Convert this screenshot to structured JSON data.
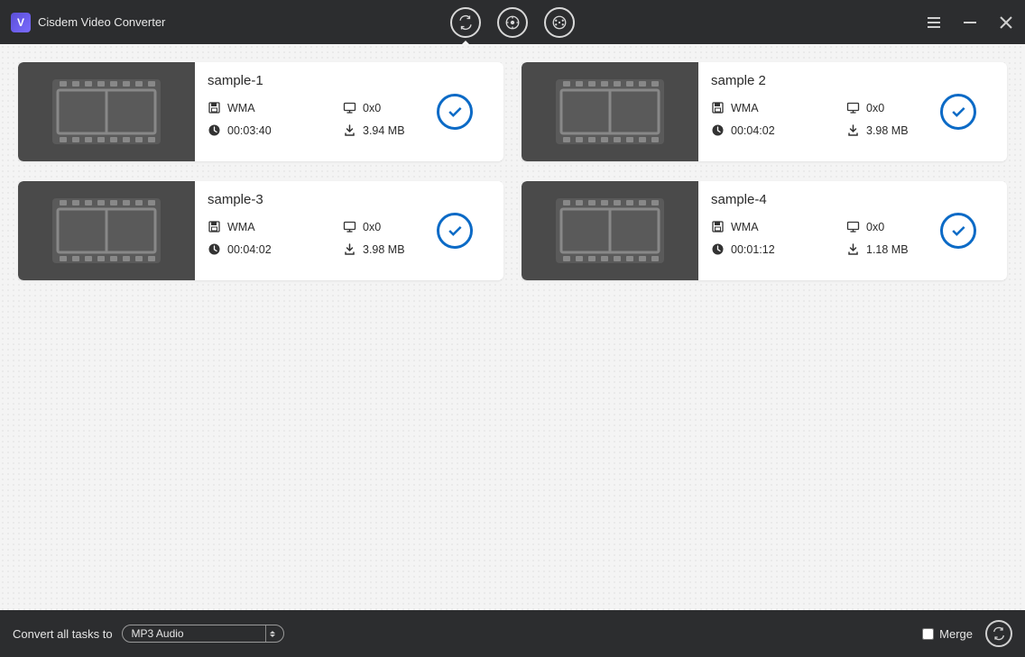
{
  "app": {
    "title": "Cisdem Video Converter",
    "logo_letter": "V"
  },
  "cards": [
    {
      "name": "sample-1",
      "format": "WMA",
      "resolution": "0x0",
      "duration": "00:03:40",
      "size": "3.94 MB"
    },
    {
      "name": "sample 2",
      "format": "WMA",
      "resolution": "0x0",
      "duration": "00:04:02",
      "size": "3.98 MB"
    },
    {
      "name": "sample-3",
      "format": "WMA",
      "resolution": "0x0",
      "duration": "00:04:02",
      "size": "3.98 MB"
    },
    {
      "name": "sample-4",
      "format": "WMA",
      "resolution": "0x0",
      "duration": "00:01:12",
      "size": "1.18 MB"
    }
  ],
  "footer": {
    "label": "Convert all tasks to",
    "format_selected": "MP3 Audio",
    "merge_label": "Merge"
  }
}
